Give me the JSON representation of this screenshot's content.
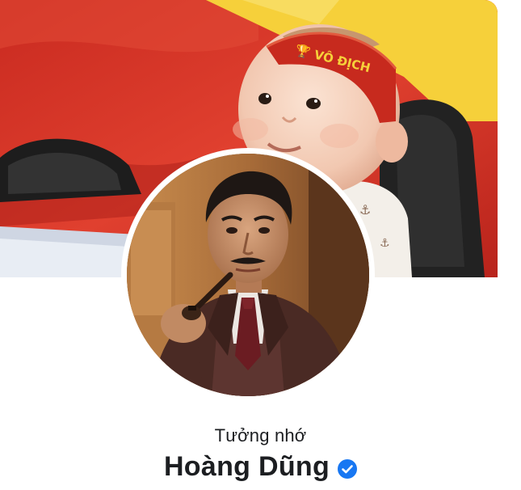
{
  "profile": {
    "memorial_label": "Tưởng nhớ",
    "name": "Hoàng Dũng",
    "verified": true
  },
  "cover": {
    "headband_text": "VÔ ĐỊCH"
  },
  "colors": {
    "flag_red": "#d8362a",
    "flag_star": "#f6d03a",
    "verified_blue": "#1877f2",
    "text": "#1c1e21"
  },
  "icons": {
    "verified": "verified-badge-icon"
  }
}
